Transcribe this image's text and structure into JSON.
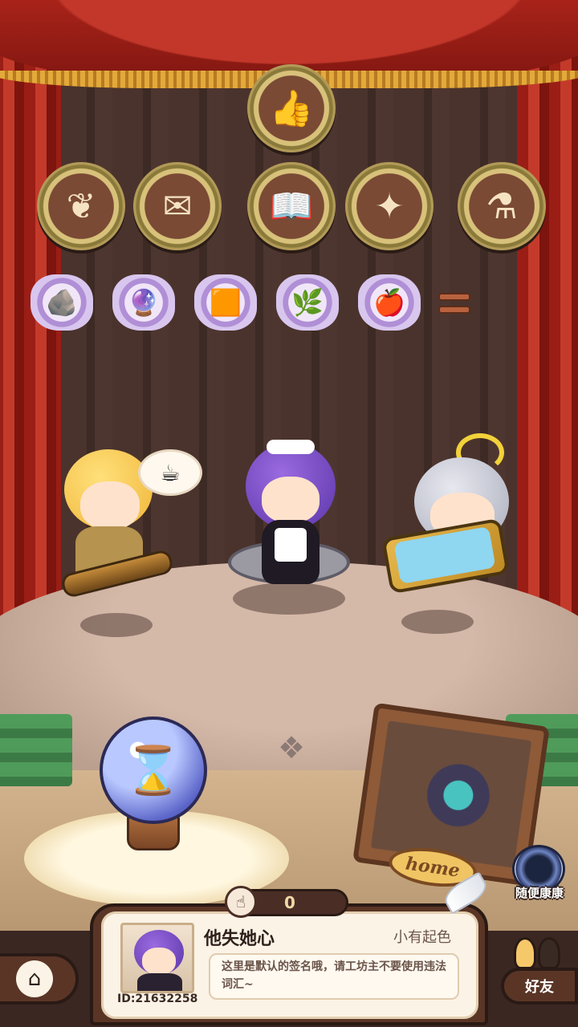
{
  "badges": [
    {
      "name": "thumbs-up-badge",
      "glyph": "👍"
    },
    {
      "name": "ornament-badge",
      "glyph": "❦"
    },
    {
      "name": "certificate-badge",
      "glyph": "✉"
    },
    {
      "name": "book-badge",
      "glyph": "📖"
    },
    {
      "name": "fairy-badge",
      "glyph": "✦"
    },
    {
      "name": "cauldron-badge",
      "glyph": "⚗"
    }
  ],
  "materials": [
    {
      "name": "ore-material",
      "glyph": "🪨"
    },
    {
      "name": "mirror-material",
      "glyph": "🔮"
    },
    {
      "name": "amber-material",
      "glyph": "🟧"
    },
    {
      "name": "herb-material",
      "glyph": "🌿"
    },
    {
      "name": "apple-material",
      "glyph": "🍎"
    }
  ],
  "speech_glyph": "☕",
  "ball_glyph": "⌛",
  "home_label": "home",
  "portal_label": "随便康康",
  "like_count": "0",
  "player": {
    "name": "他失她心",
    "rank": "小有起色",
    "signature": "这里是默认的签名哦，请工坊主不要使用违法词汇~",
    "id": "ID:21632258"
  },
  "nav": {
    "home_glyph": "⌂",
    "friends_label": "好友"
  }
}
